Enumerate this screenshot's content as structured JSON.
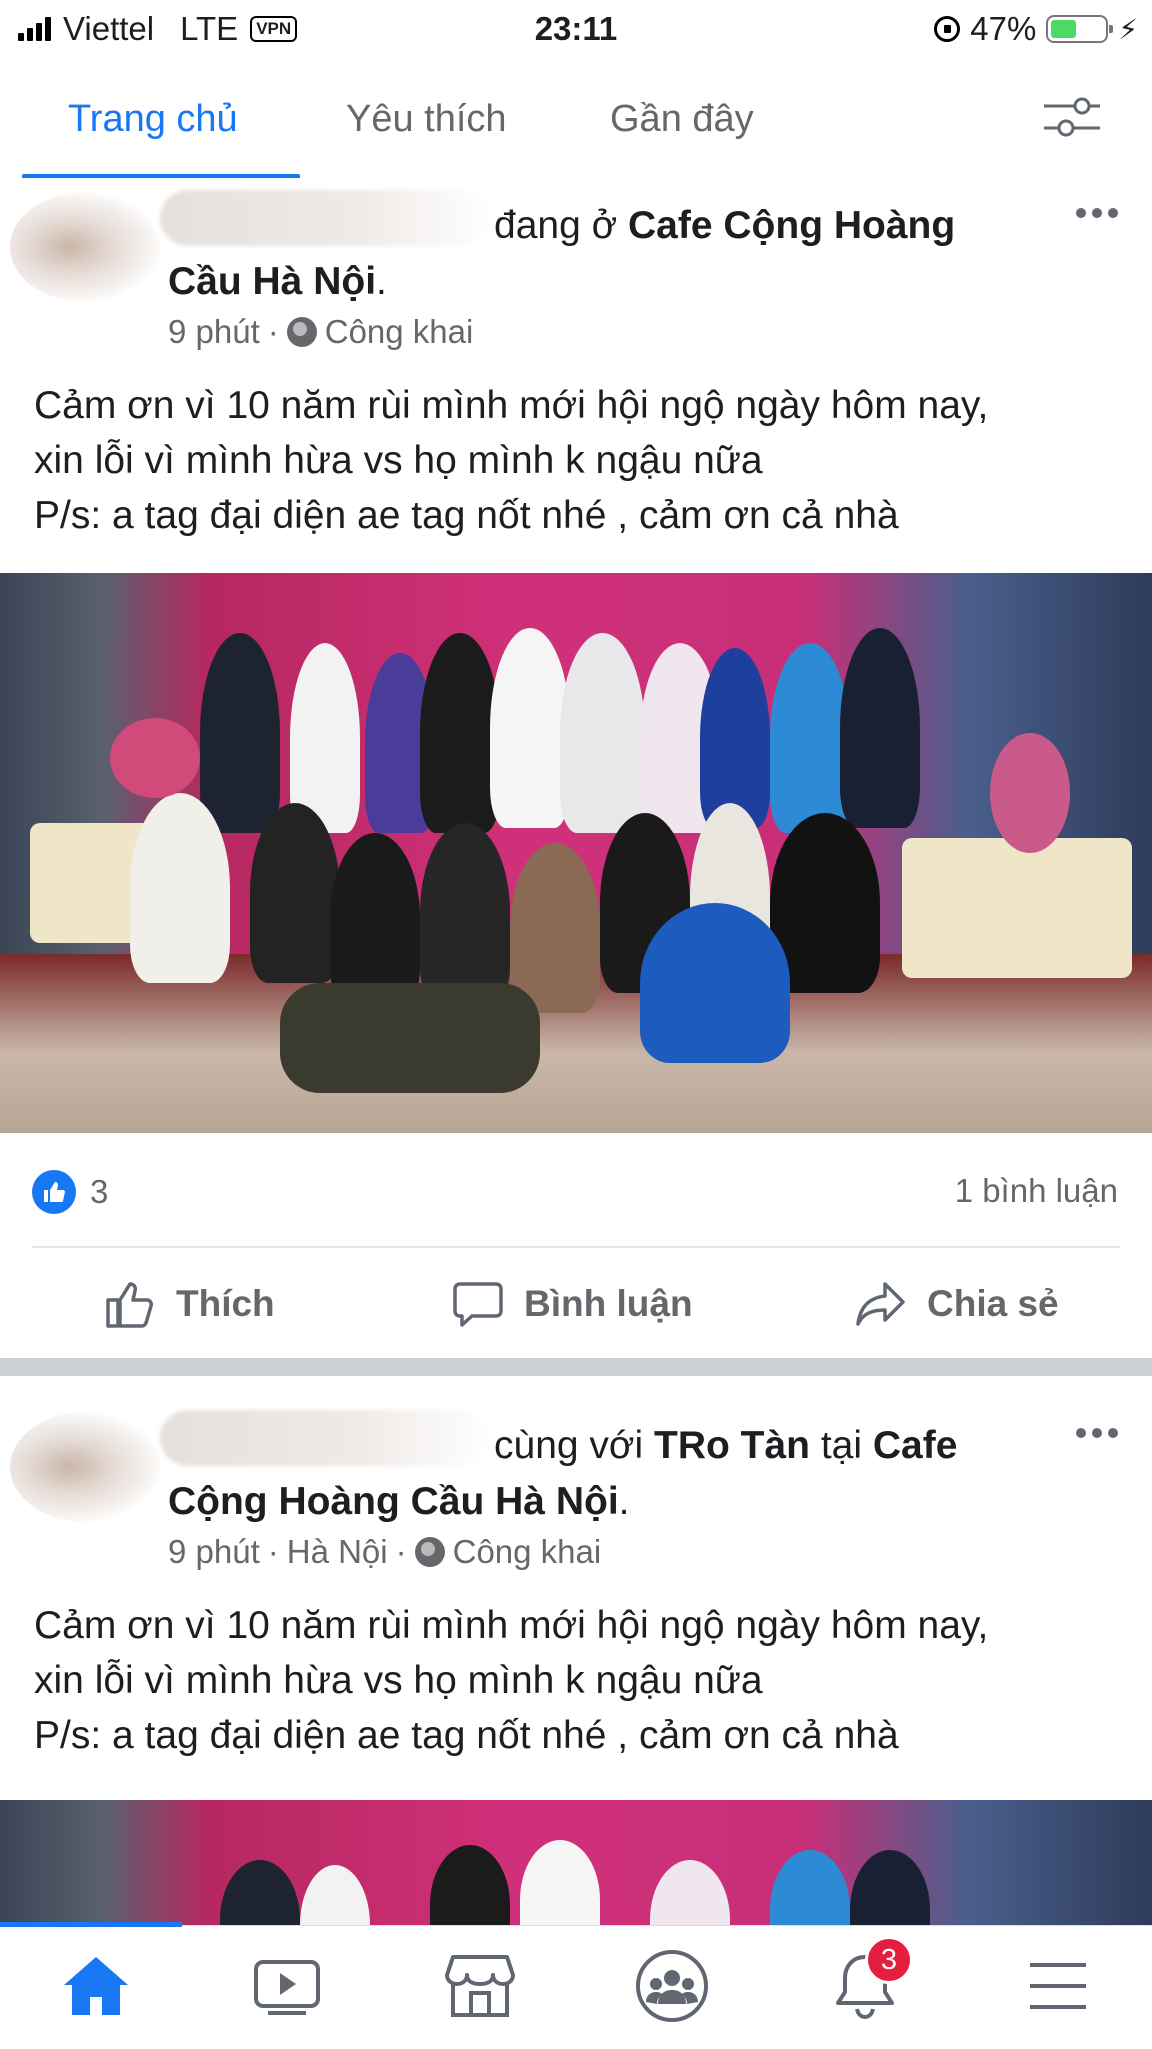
{
  "status_bar": {
    "carrier": "Viettel",
    "network": "LTE",
    "vpn": "VPN",
    "time": "23:11",
    "battery_percent": "47%",
    "battery_level": 0.47
  },
  "tabs": [
    {
      "label": "Trang chủ",
      "active": true
    },
    {
      "label": "Yêu thích",
      "active": false
    },
    {
      "label": "Gần đây",
      "active": false
    }
  ],
  "posts": [
    {
      "header_action": "đang ở",
      "header_place": "Cafe Cộng Hoàng",
      "header_place_line2": "Cầu Hà Nội",
      "meta_time": "9 phút",
      "meta_privacy": "Công khai",
      "body": [
        "Cảm ơn vì 10 năm rùi mình mới hội ngộ ngày hôm nay,",
        "xin lỗi vì mình hừa vs họ mình k ngậu nữa",
        "P/s: a tag đại diện ae tag nốt nhé , cảm ơn cả nhà"
      ],
      "reaction_count": "3",
      "comment_count": "1 bình luận",
      "actions": {
        "like": "Thích",
        "comment": "Bình luận",
        "share": "Chia sẻ"
      }
    },
    {
      "header_action": "cùng với",
      "header_tagged": "TRo Tàn",
      "header_at": "tại",
      "header_place": "Cafe",
      "header_place_line2": "Cộng Hoàng Cầu Hà Nội",
      "meta_time": "9 phút",
      "meta_location": "Hà Nội",
      "meta_privacy": "Công khai",
      "body": [
        "Cảm ơn vì 10 năm rùi mình mới hội ngộ ngày hôm nay,",
        "xin lỗi vì mình hừa vs họ mình k ngậu nữa",
        "P/s: a tag đại diện ae tag nốt nhé , cảm ơn cả nhà"
      ]
    }
  ],
  "bottom_nav": {
    "items": [
      "home-icon",
      "video-icon",
      "marketplace-icon",
      "groups-icon",
      "notifications-icon",
      "menu-icon"
    ],
    "notification_badge": "3"
  },
  "colors": {
    "accent": "#1877f2",
    "secondary_text": "#65676b",
    "badge": "#e41e3f"
  }
}
